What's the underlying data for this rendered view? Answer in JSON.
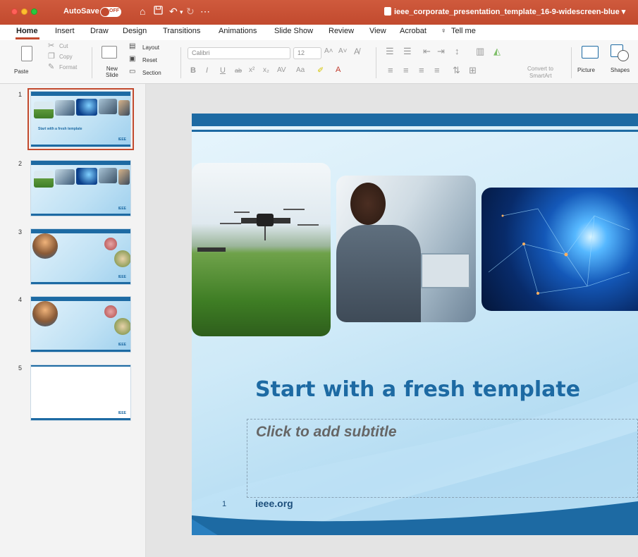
{
  "titlebar": {
    "autosave_label": "AutoSave",
    "autosave_state": "OFF",
    "document_title": "ieee_corporate_presentation_template_16-9-widescreen-blue"
  },
  "tabs": [
    "Home",
    "Insert",
    "Draw",
    "Design",
    "Transitions",
    "Animations",
    "Slide Show",
    "Review",
    "View",
    "Acrobat",
    "Tell me"
  ],
  "ribbon": {
    "paste": "Paste",
    "cut": "Cut",
    "copy": "Copy",
    "format": "Format",
    "new_slide": "New\nSlide",
    "layout": "Layout",
    "reset": "Reset",
    "section": "Section",
    "font_name": "Calibri",
    "font_size": "12",
    "convert_smartart_1": "Convert to",
    "convert_smartart_2": "SmartArt",
    "picture": "Picture",
    "shapes": "Shapes"
  },
  "thumbnails": [
    {
      "number": "1",
      "title": "Start with a fresh template",
      "logo": "IEEE"
    },
    {
      "number": "2",
      "logo": "IEEE"
    },
    {
      "number": "3",
      "logo": "IEEE"
    },
    {
      "number": "4",
      "logo": "IEEE"
    },
    {
      "number": "5",
      "logo": "IEEE"
    }
  ],
  "slide": {
    "title": "Start with a fresh template",
    "subtitle_placeholder": "Click to add subtitle",
    "slide_number": "1",
    "footer_url": "ieee.org"
  },
  "colors": {
    "titlebar": "#c24a2e",
    "ieee_blue": "#1d6aa3",
    "selection": "#c24a2e"
  }
}
